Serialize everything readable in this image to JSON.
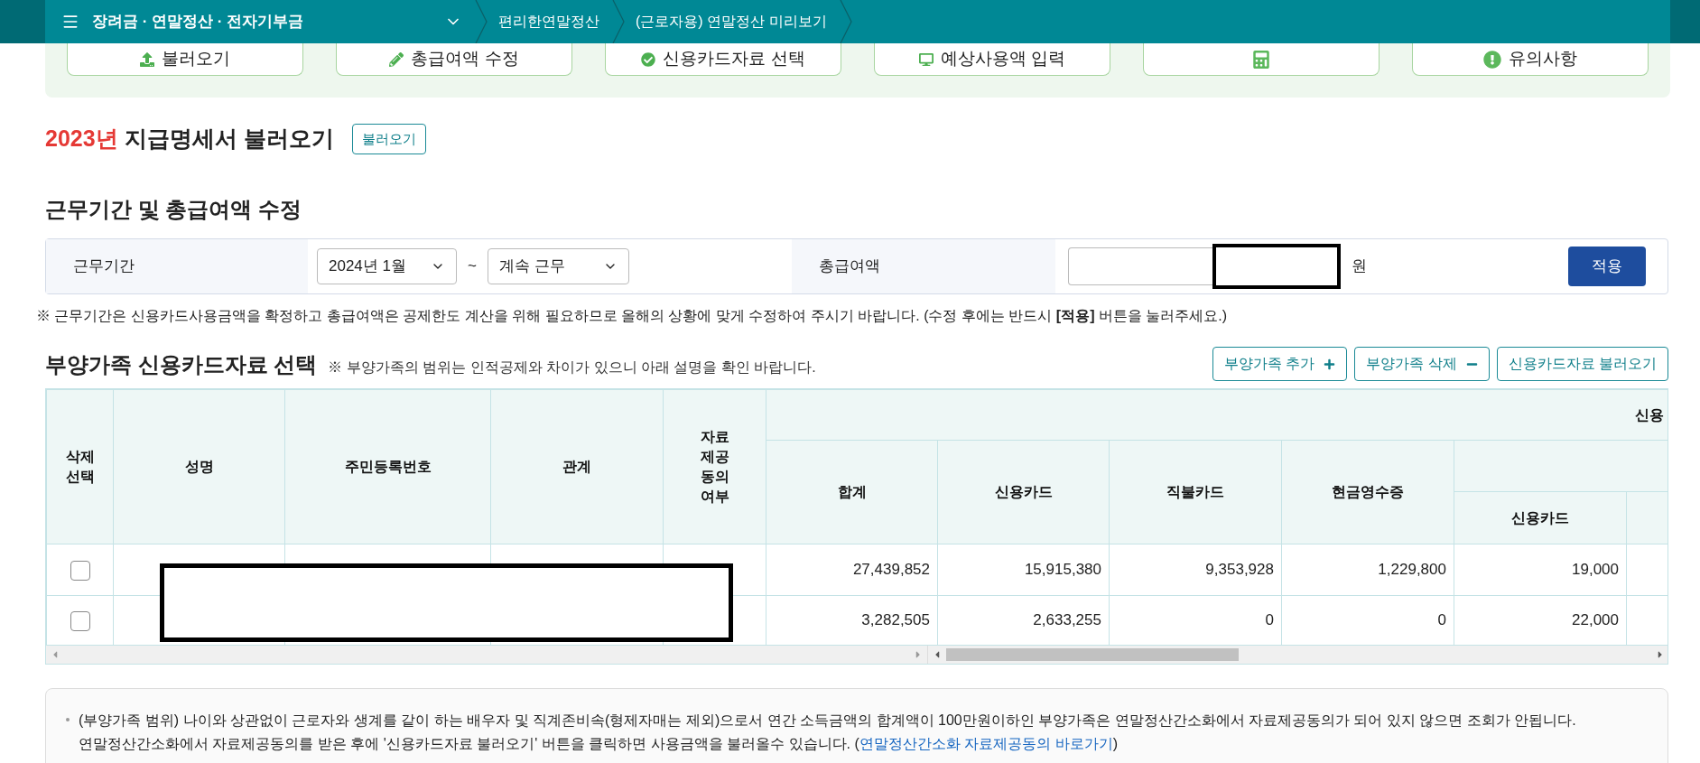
{
  "header": {
    "menu": "장려금 · 연말정산 · 전자기부금",
    "breadcrumbs": [
      "편리한연말정산",
      "(근로자용) 연말정산 미리보기"
    ]
  },
  "steps": [
    {
      "kind": "upload",
      "label": "불러오기"
    },
    {
      "kind": "edit",
      "label": "총급여액 수정"
    },
    {
      "kind": "check",
      "label": "신용카드자료 선택"
    },
    {
      "kind": "input",
      "label": "예상사용액 입력"
    },
    {
      "kind": "calc"
    },
    {
      "kind": "notice",
      "label": "유의사항"
    }
  ],
  "statement": {
    "year": "2023년",
    "title": "지급명세서 불러오기",
    "button": "불러오기"
  },
  "period": {
    "title": "근무기간 및 총급여액 수정",
    "label": "근무기간",
    "start": "2024년 1월",
    "tilde": "~",
    "end": "계속 근무",
    "salary_label": "총급여액",
    "unit": "원",
    "apply": "적용",
    "note": "※ 근무기간은 신용카드사용금액을 확정하고 총급여액은 공제한도 계산을 위해 필요하므로 올해의 상황에 맞게 수정하여 주시기 바랍니다. (수정 후에는 반드시 **[적용]** 버튼을 눌러주세요.)"
  },
  "dependents": {
    "title": "부양가족 신용카드자료 선택",
    "note": "※ 부양가족의 범위는 인적공제와 차이가 있으니 아래 설명을 확인 바랍니다.",
    "buttons": [
      {
        "kind": "add",
        "label": "부양가족 추가"
      },
      {
        "kind": "remove",
        "label": "부양가족 삭제"
      },
      {
        "kind": "load",
        "label": "신용카드자료 불러오기"
      }
    ],
    "fixed_columns": [
      "삭제\n선택",
      "성명",
      "주민등록번호",
      "관계",
      "자료\n제공\n동의\n여부"
    ],
    "group_header": "신용",
    "columns": [
      "합계",
      "신용카드",
      "직불카드",
      "현금영수증"
    ],
    "sub_columns": [
      "신용카드"
    ],
    "rows": [
      {
        "checked": false,
        "values": [
          "27,439,852",
          "15,915,380",
          "9,353,928",
          "1,229,800",
          "19,000"
        ]
      },
      {
        "checked": false,
        "values": [
          "3,282,505",
          "2,633,255",
          "0",
          "0",
          "22,000"
        ]
      }
    ]
  },
  "info": {
    "line1": "(부양가족 범위) 나이와 상관없이 근로자와 생계를 같이 하는 배우자 및 직계존비속(형제자매는 제외)으로서 연간 소득금액의 합계액이 100만원이하인 부양가족은 연말정산간소화에서 자료제공동의가 되어 있지 않으면 조회가 안됩니다.",
    "line2": "연말정산간소화에서 자료제공동의를 받은 후에 '신용카드자료 불러오기' 버튼을 클릭하면 사용금액을 불러올수 있습니다. (",
    "link": "연말정산간소화 자료제공동의 바로가기",
    "line2_end": ")"
  }
}
